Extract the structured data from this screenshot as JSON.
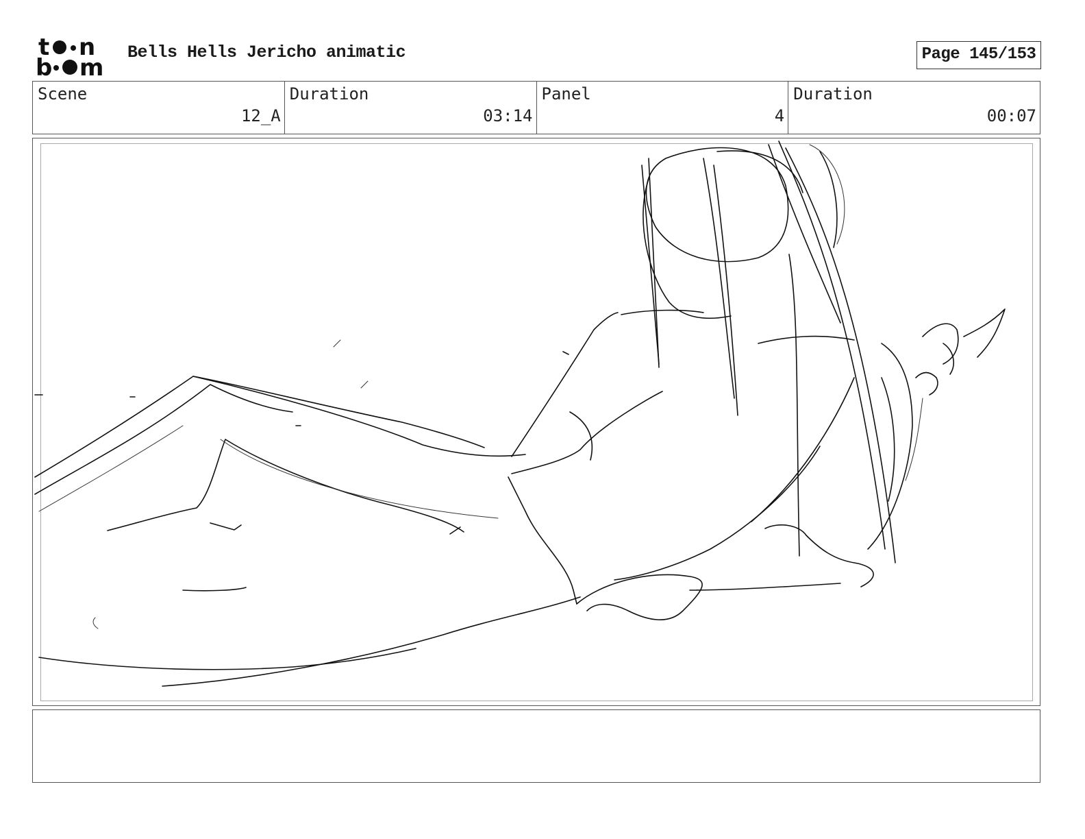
{
  "header": {
    "project_title": "Bells Hells Jericho animatic",
    "page_label": "Page 145/153"
  },
  "info": {
    "scene_label": "Scene",
    "scene_value": "12_A",
    "scene_duration_label": "Duration",
    "scene_duration_value": "03:14",
    "panel_label": "Panel",
    "panel_value": "4",
    "panel_duration_label": "Duration",
    "panel_duration_value": "00:07"
  },
  "notes": {
    "text": ""
  },
  "icons": {
    "logo": "toonboom-logo-icon"
  },
  "colors": {
    "ink": "#111111",
    "frame": "#555555",
    "background": "#ffffff"
  }
}
